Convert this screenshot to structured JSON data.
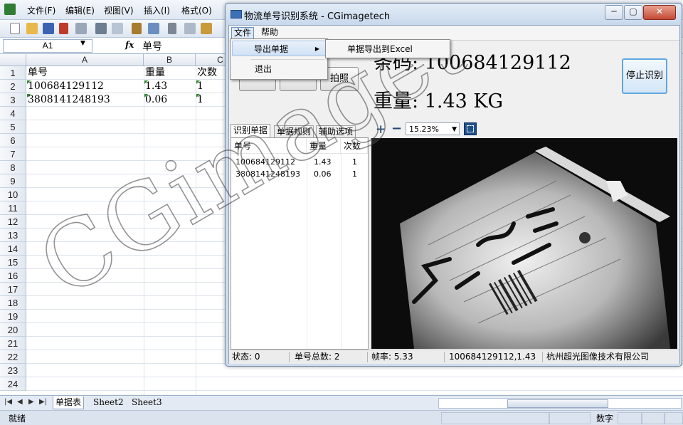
{
  "excel": {
    "menus": [
      "文件(F)",
      "编辑(E)",
      "视图(V)",
      "插入(I)",
      "格式(O)"
    ],
    "name_box": "A1",
    "fx_label": "fx",
    "formula_value": "单号",
    "columns": [
      "A",
      "B",
      "C"
    ],
    "rows": [
      "1",
      "2",
      "3",
      "4",
      "5",
      "6",
      "7",
      "8",
      "9",
      "10",
      "11",
      "12",
      "13",
      "14",
      "15",
      "16",
      "17",
      "18",
      "19",
      "20",
      "21",
      "22",
      "23",
      "24"
    ],
    "cells": {
      "a1": "单号",
      "b1": "重量",
      "c1": "次数",
      "a2": "100684129112",
      "b2": "1.43",
      "c2": "1",
      "a3": "3808141248193",
      "b3": "0.06",
      "c3": "1"
    },
    "sheets": [
      "单据表",
      "Sheet2",
      "Sheet3"
    ],
    "status_ready": "就绪",
    "status_mode": "数字"
  },
  "app": {
    "title": "物流单号识别系统 - CGimagetech",
    "menus": [
      "文件",
      "帮助"
    ],
    "file_menu": {
      "export": "导出单据",
      "exit": "退出",
      "export_excel": "单据导出到Excel"
    },
    "photo_button": "拍照",
    "barcode_display": "条码: 100684129112",
    "weight_display": "重量: 1.43 KG",
    "stop_button": "停止识别",
    "tabs": [
      "识别单据",
      "单据规则",
      "辅助选项"
    ],
    "list_headers": [
      "单号",
      "重量",
      "次数"
    ],
    "list_rows": [
      [
        "100684129112",
        "1.43",
        "1"
      ],
      [
        "3808141248193",
        "0.06",
        "1"
      ]
    ],
    "zoom_plus": "+",
    "zoom_minus": "−",
    "zoom_value": "15.23%",
    "status": {
      "state": "状态: 0",
      "total": "单号总数: 2",
      "fps": "帧率: 5.33",
      "last": "100684129112,1.43",
      "company": "杭州超光图像技术有限公司"
    }
  },
  "watermark": "CGimagetech"
}
